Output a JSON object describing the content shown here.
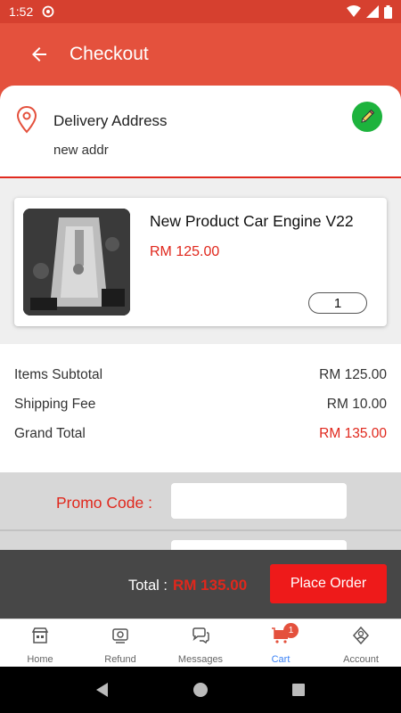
{
  "status": {
    "time": "1:52"
  },
  "header": {
    "title": "Checkout"
  },
  "address": {
    "label": "Delivery Address",
    "value": "new addr"
  },
  "product": {
    "name": "New Product Car Engine V22",
    "price": "RM 125.00",
    "quantity": "1"
  },
  "summary": {
    "subtotal_label": "Items Subtotal",
    "subtotal_value": "RM 125.00",
    "shipping_label": "Shipping Fee",
    "shipping_value": "RM 10.00",
    "grand_label": "Grand Total",
    "grand_value": "RM 135.00"
  },
  "promo": {
    "label": "Promo Code :",
    "value": ""
  },
  "footer": {
    "total_label": "Total :",
    "total_value": "RM 135.00",
    "place_order": "Place Order"
  },
  "tabs": [
    {
      "label": "Home",
      "icon": "store-icon"
    },
    {
      "label": "Refund",
      "icon": "refund-icon"
    },
    {
      "label": "Messages",
      "icon": "chat-icon"
    },
    {
      "label": "Cart",
      "icon": "cart-icon",
      "badge": "1",
      "active": true
    },
    {
      "label": "Account",
      "icon": "account-icon"
    }
  ],
  "colors": {
    "accent": "#e4513d",
    "price": "#e0271c",
    "active_tab": "#3b82f6",
    "edit": "#1db33d"
  }
}
